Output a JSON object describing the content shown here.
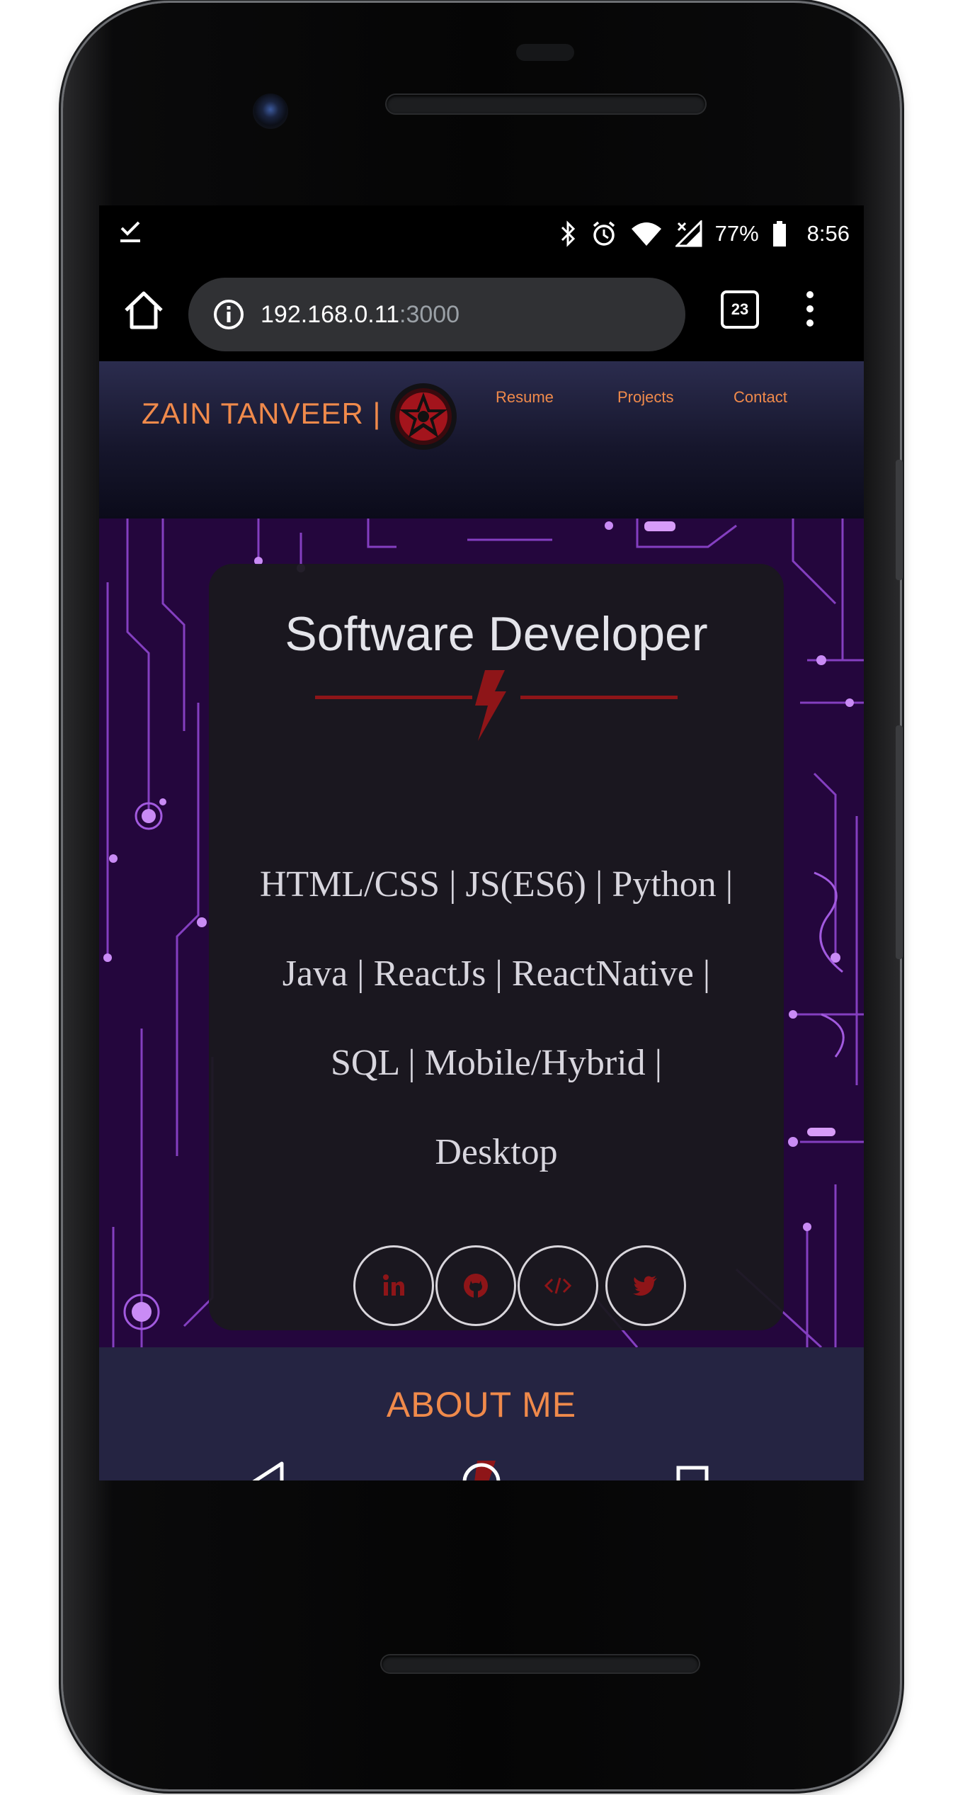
{
  "status_bar": {
    "battery": "77%",
    "time": "8:56"
  },
  "browser": {
    "url_host": "192.168.0.11",
    "url_port": ":3000",
    "tab_count": "23"
  },
  "site": {
    "brand": "ZAIN TANVEER |",
    "nav": {
      "resume": "Resume",
      "projects": "Projects",
      "contact": "Contact"
    },
    "hero": {
      "title": "Software Developer",
      "skills_lines": [
        "HTML/CSS | JS(ES6) | Python |",
        "Java | ReactJs | ReactNative |",
        "SQL | Mobile/Hybrid |",
        "Desktop"
      ],
      "socials": [
        "linkedin-icon",
        "github-icon",
        "code-icon",
        "twitter-icon"
      ]
    },
    "about": {
      "title": "ABOUT ME"
    }
  },
  "colors": {
    "accent_orange": "#f08a4b",
    "bolt_red": "#8e1518",
    "hero_bg": "#24063d",
    "circuit": "#b86cf0"
  }
}
